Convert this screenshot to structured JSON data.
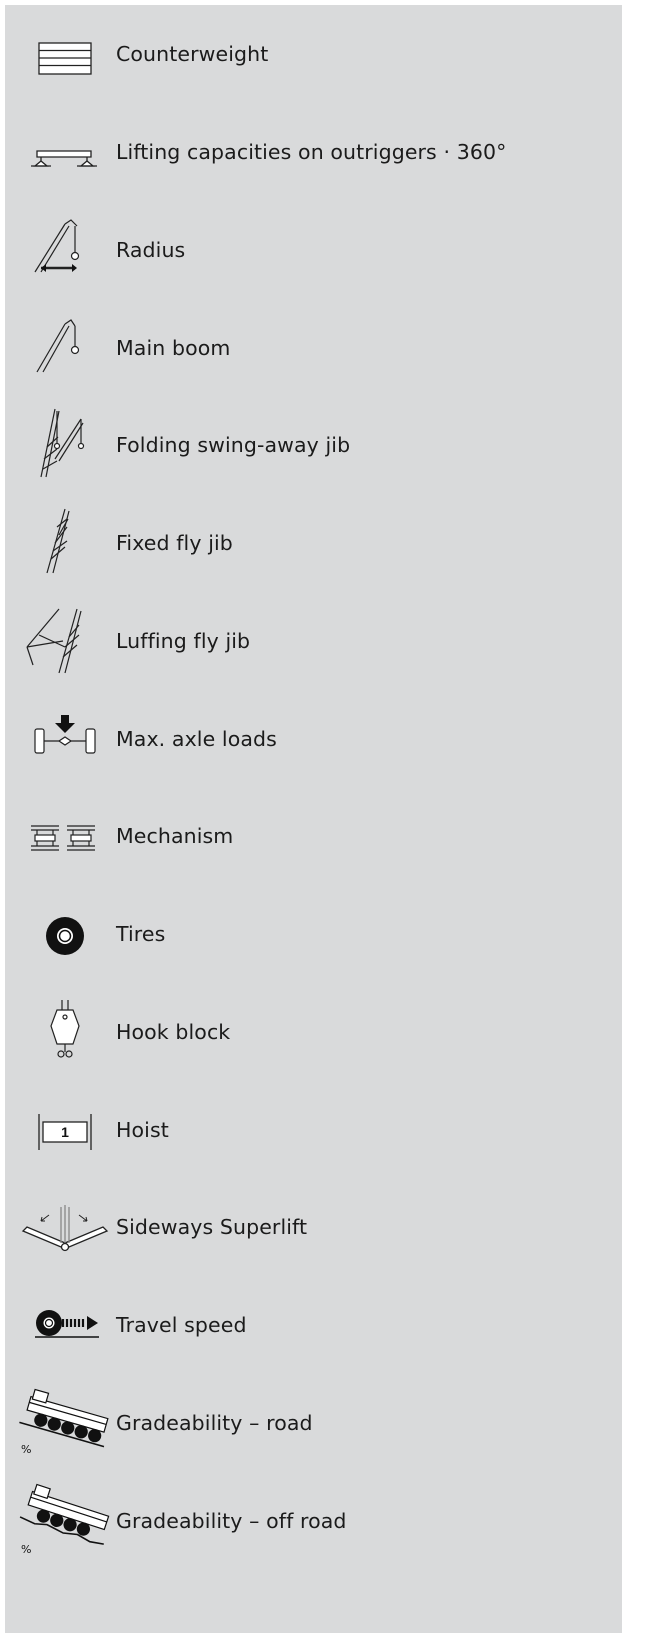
{
  "legend": {
    "items": [
      {
        "icon": "counterweight-icon",
        "label": "Counterweight"
      },
      {
        "icon": "outriggers-icon",
        "label": "Lifting capacities on outriggers · 360°"
      },
      {
        "icon": "radius-icon",
        "label": "Radius"
      },
      {
        "icon": "main-boom-icon",
        "label": "Main boom"
      },
      {
        "icon": "folding-jib-icon",
        "label": "Folding swing-away jib"
      },
      {
        "icon": "fixed-fly-jib-icon",
        "label": "Fixed fly jib"
      },
      {
        "icon": "luffing-fly-jib-icon",
        "label": "Luffing fly jib"
      },
      {
        "icon": "axle-loads-icon",
        "label": "Max. axle loads"
      },
      {
        "icon": "mechanism-icon",
        "label": "Mechanism"
      },
      {
        "icon": "tire-icon",
        "label": "Tires"
      },
      {
        "icon": "hook-block-icon",
        "label": "Hook block"
      },
      {
        "icon": "hoist-icon",
        "label": "Hoist",
        "badge": "1"
      },
      {
        "icon": "sideways-superlift-icon",
        "label": "Sideways Superlift"
      },
      {
        "icon": "travel-speed-icon",
        "label": "Travel speed"
      },
      {
        "icon": "gradeability-road-icon",
        "label": "Gradeability – road",
        "unit": "%"
      },
      {
        "icon": "gradeability-offroad-icon",
        "label": "Gradeability – off road",
        "unit": "%"
      }
    ]
  }
}
